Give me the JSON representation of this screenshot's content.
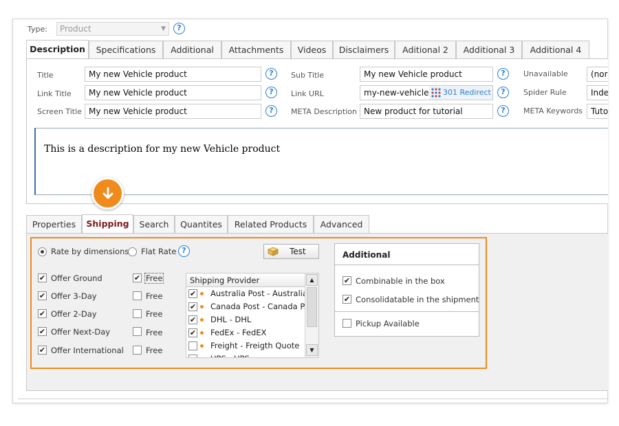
{
  "type_field": {
    "label": "Type:",
    "value": "Product"
  },
  "top_tabs": [
    "Description",
    "Specifications",
    "Additional",
    "Attachments",
    "Videos",
    "Disclaimers",
    "Aditional 2",
    "Additional 3",
    "Additional 4"
  ],
  "fields": {
    "title": {
      "label": "Title",
      "value": "My new Vehicle product"
    },
    "link_title": {
      "label": "Link Title",
      "value": "My new Vehicle product"
    },
    "screen_title": {
      "label": "Screen Title",
      "value": "My new Vehicle product"
    },
    "sub_title": {
      "label": "Sub Title",
      "value": "My new Vehicle product"
    },
    "link_url": {
      "label": "Link URL",
      "value": "my-new-vehicle-",
      "redirect": "301 Redirect"
    },
    "meta_description": {
      "label": "META Description",
      "value": "New product for tutorial"
    },
    "unavailable": {
      "label": "Unavailable",
      "value": "(nor"
    },
    "spider_rule": {
      "label": "Spider Rule",
      "value": "Inde"
    },
    "meta_keywords": {
      "label": "META Keywords",
      "value": "Tuto"
    }
  },
  "description_text": "This is a description for my new Vehicle product",
  "bottom_tabs": [
    "Properties",
    "Shipping",
    "Search",
    "Quantites",
    "Related Products",
    "Advanced"
  ],
  "shipping": {
    "rate_by_dimensions": "Rate by dimensions",
    "flat_rate": "Flat Rate",
    "test_button": "Test",
    "offers": [
      {
        "label": "Offer Ground",
        "checked": true,
        "free": "Free",
        "free_checked": true
      },
      {
        "label": "Offer 3-Day",
        "checked": true,
        "free": "Free",
        "free_checked": false
      },
      {
        "label": "Offer 2-Day",
        "checked": true,
        "free": "Free",
        "free_checked": false
      },
      {
        "label": "Offer Next-Day",
        "checked": true,
        "free": "Free",
        "free_checked": false
      },
      {
        "label": "Offer International",
        "checked": true,
        "free": "Free",
        "free_checked": false
      }
    ],
    "provider_header": "Shipping Provider",
    "providers": [
      {
        "label": "Australia Post - Australia...",
        "checked": true
      },
      {
        "label": "Canada Post - Canada P...",
        "checked": true
      },
      {
        "label": "DHL - DHL",
        "checked": true
      },
      {
        "label": "FedEx - FedEX",
        "checked": true
      },
      {
        "label": "Freight - Freigth Quote",
        "checked": false
      },
      {
        "label": "UPS - UPS",
        "checked": false
      }
    ]
  },
  "additional": {
    "title": "Additional",
    "combinable": "Combinable in the box",
    "consolidatable": "Consolidatable in the shipment",
    "pickup": "Pickup Available"
  },
  "colors": {
    "accent": "#f08a1c",
    "help_blue": "#2a7fd4",
    "active_tab_red": "#7a1b1b"
  }
}
